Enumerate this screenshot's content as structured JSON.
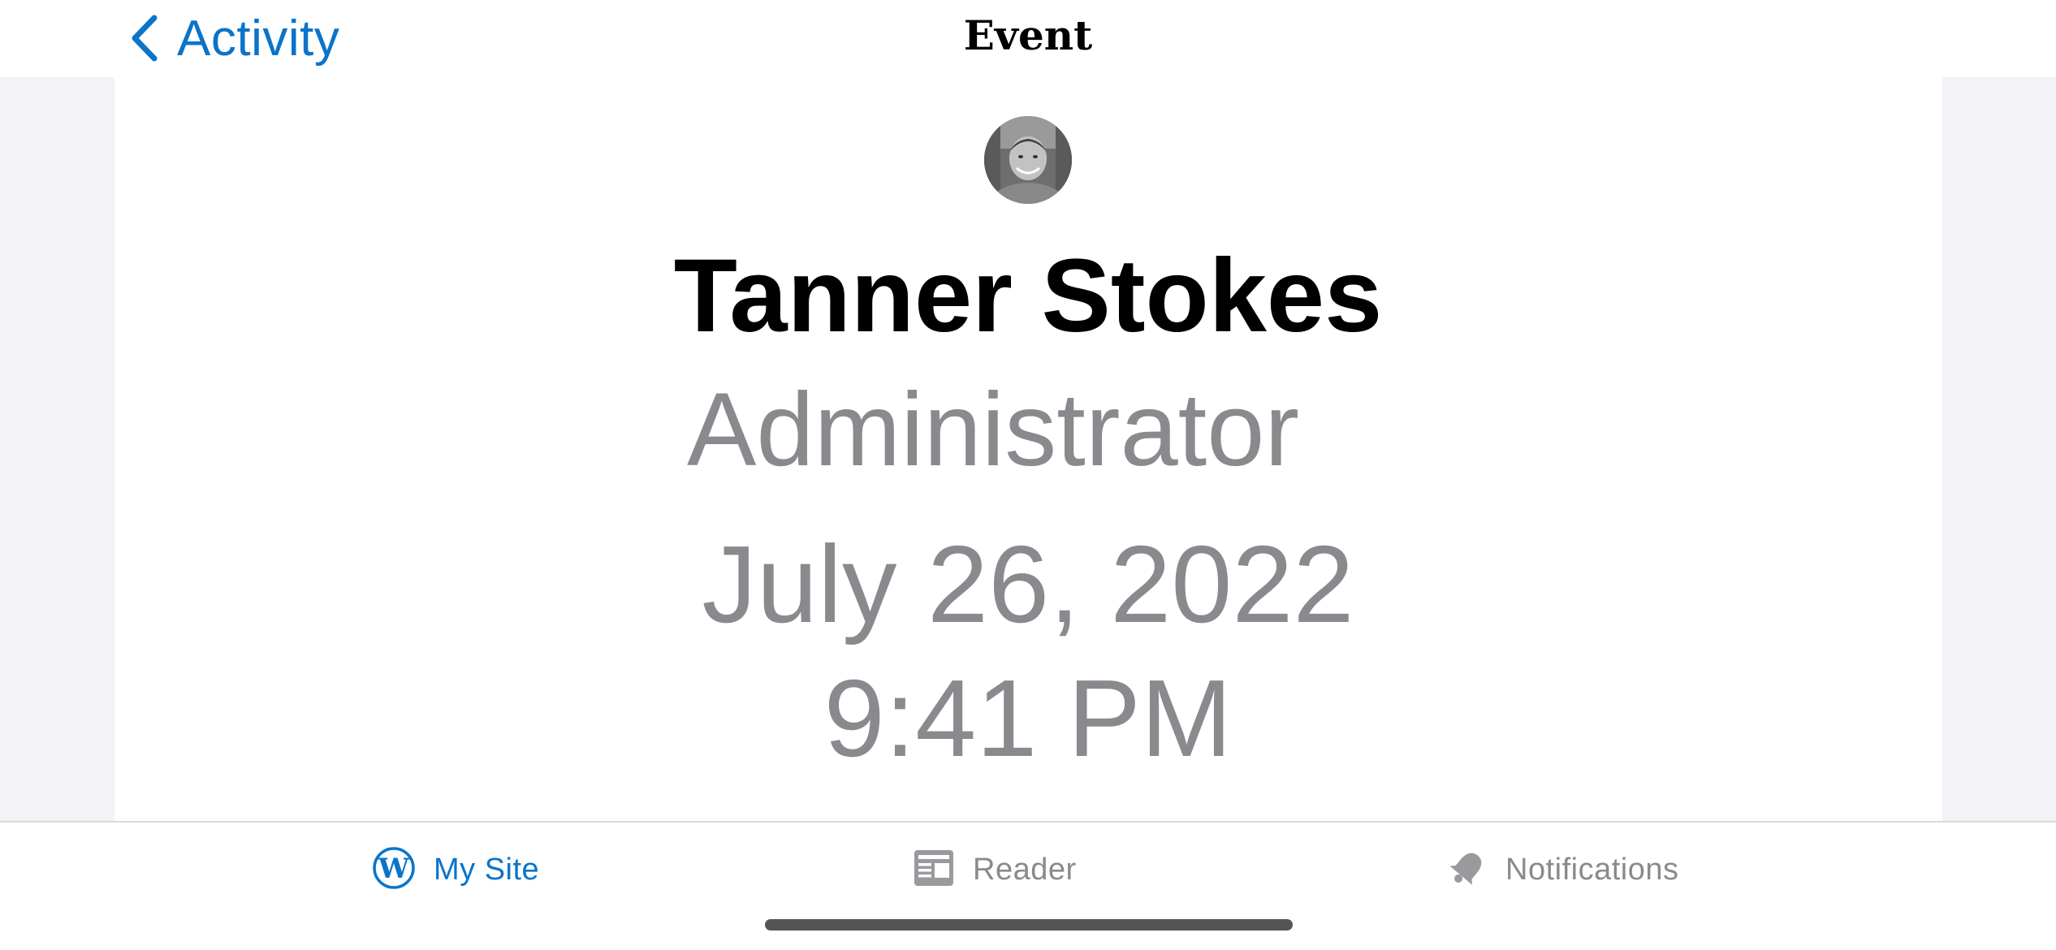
{
  "nav": {
    "back_label": "Activity",
    "title": "Event"
  },
  "event": {
    "user_name": "Tanner Stokes",
    "user_role": "Administrator",
    "date": "July 26, 2022",
    "time": "9:41 PM"
  },
  "tab_bar": {
    "tabs": [
      {
        "label": "My Site",
        "icon": "wordpress-icon",
        "active": true
      },
      {
        "label": "Reader",
        "icon": "reader-icon",
        "active": false
      },
      {
        "label": "Notifications",
        "icon": "bell-icon",
        "active": false
      }
    ]
  },
  "colors": {
    "accent": "#0a74c9",
    "secondary_text": "#8a8a8e",
    "gutter": "#f2f2f7"
  }
}
